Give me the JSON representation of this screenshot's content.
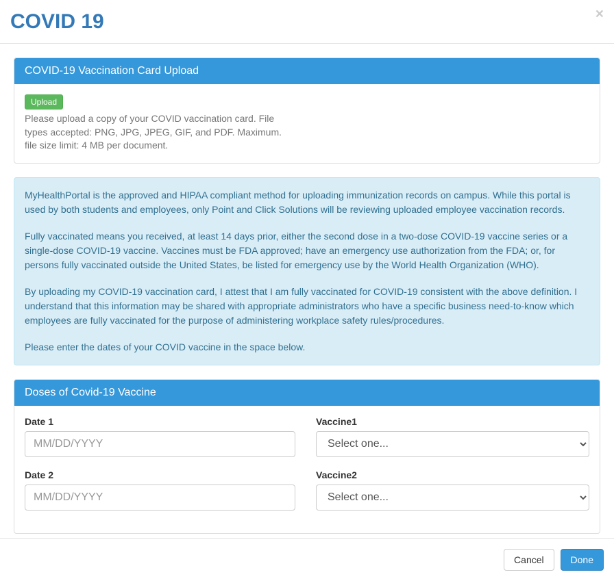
{
  "header": {
    "title": "COVID 19",
    "close_label": "×"
  },
  "upload_panel": {
    "heading": "COVID-19 Vaccination Card Upload",
    "upload_button": "Upload",
    "help_line1": "Please upload a copy of your COVID vaccination card. File",
    "help_line2": "types accepted: PNG, JPG, JPEG, GIF, and PDF. Maximum.",
    "help_line3": "file size limit: 4 MB per document."
  },
  "info": {
    "p1": "MyHealthPortal is the approved and HIPAA compliant method for uploading immunization records on campus. While this portal is used by both students and employees, only Point and Click Solutions will be reviewing uploaded employee vaccination records.",
    "p2": "Fully vaccinated means you received, at least 14 days prior, either the second dose in a two-dose COVID-19 vaccine series or a single-dose COVID-19 vaccine. Vaccines must be FDA approved; have an emergency use authorization from the FDA; or, for persons fully vaccinated outside the United States, be listed for emergency use by the World Health Organization (WHO).",
    "p3": "By uploading my COVID-19 vaccination card, I attest that I am fully vaccinated for COVID-19 consistent with the above definition. I understand that this information may be shared with appropriate administrators who have a specific business need-to-know which employees are fully vaccinated for the purpose of administering workplace safety rules/procedures.",
    "p4": "Please enter the dates of your COVID vaccine in the space below."
  },
  "doses_panel": {
    "heading": "Doses of Covid-19 Vaccine",
    "rows": [
      {
        "date_label": "Date 1",
        "date_placeholder": "MM/DD/YYYY",
        "vaccine_label": "Vaccine1",
        "vaccine_placeholder": "Select one..."
      },
      {
        "date_label": "Date 2",
        "date_placeholder": "MM/DD/YYYY",
        "vaccine_label": "Vaccine2",
        "vaccine_placeholder": "Select one..."
      }
    ]
  },
  "footer": {
    "cancel": "Cancel",
    "done": "Done"
  }
}
